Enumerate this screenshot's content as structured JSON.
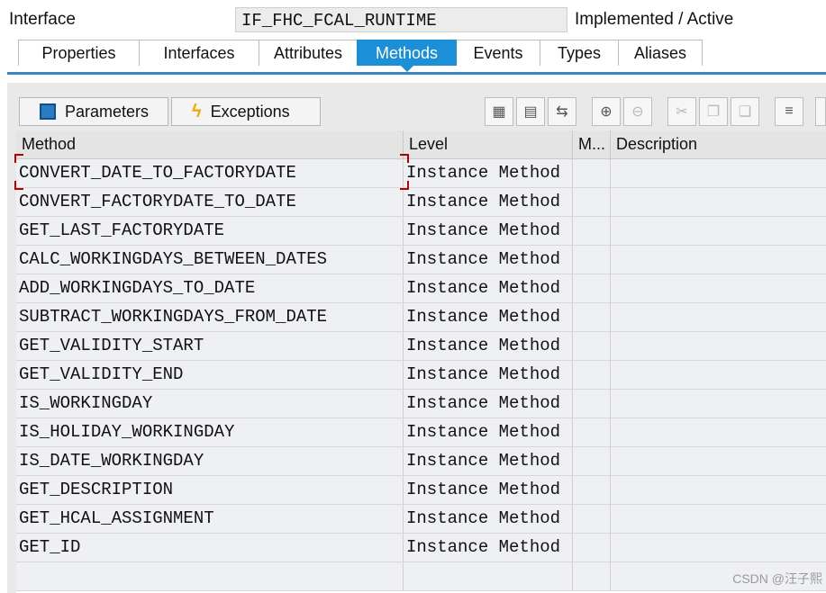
{
  "header": {
    "label": "Interface",
    "interface_name": "IF_FHC_FCAL_RUNTIME",
    "status": "Implemented / Active"
  },
  "tabs": [
    {
      "label": "Properties"
    },
    {
      "label": "Interfaces"
    },
    {
      "label": "Attributes"
    },
    {
      "label": "Methods"
    },
    {
      "label": "Events"
    },
    {
      "label": "Types"
    },
    {
      "label": "Aliases"
    }
  ],
  "active_tab": "Methods",
  "toolbar": {
    "parameters_label": "Parameters",
    "exceptions_label": "Exceptions"
  },
  "table": {
    "columns": [
      "Method",
      "Level",
      "M...",
      "Description"
    ],
    "rows": [
      {
        "method": "CONVERT_DATE_TO_FACTORYDATE",
        "level": "Instance Method",
        "m": "",
        "desc": ""
      },
      {
        "method": "CONVERT_FACTORYDATE_TO_DATE",
        "level": "Instance Method",
        "m": "",
        "desc": ""
      },
      {
        "method": "GET_LAST_FACTORYDATE",
        "level": "Instance Method",
        "m": "",
        "desc": ""
      },
      {
        "method": "CALC_WORKINGDAYS_BETWEEN_DATES",
        "level": "Instance Method",
        "m": "",
        "desc": ""
      },
      {
        "method": "ADD_WORKINGDAYS_TO_DATE",
        "level": "Instance Method",
        "m": "",
        "desc": ""
      },
      {
        "method": "SUBTRACT_WORKINGDAYS_FROM_DATE",
        "level": "Instance Method",
        "m": "",
        "desc": ""
      },
      {
        "method": "GET_VALIDITY_START",
        "level": "Instance Method",
        "m": "",
        "desc": ""
      },
      {
        "method": "GET_VALIDITY_END",
        "level": "Instance Method",
        "m": "",
        "desc": ""
      },
      {
        "method": "IS_WORKINGDAY",
        "level": "Instance Method",
        "m": "",
        "desc": ""
      },
      {
        "method": "IS_HOLIDAY_WORKINGDAY",
        "level": "Instance Method",
        "m": "",
        "desc": ""
      },
      {
        "method": "IS_DATE_WORKINGDAY",
        "level": "Instance Method",
        "m": "",
        "desc": ""
      },
      {
        "method": "GET_DESCRIPTION",
        "level": "Instance Method",
        "m": "",
        "desc": ""
      },
      {
        "method": "GET_HCAL_ASSIGNMENT",
        "level": "Instance Method",
        "m": "",
        "desc": ""
      },
      {
        "method": "GET_ID",
        "level": "Instance Method",
        "m": "",
        "desc": ""
      }
    ]
  },
  "watermark": "CSDN @汪子熙",
  "colors": {
    "accent": "#1b8fd8",
    "tab_line": "#3a86c5"
  }
}
